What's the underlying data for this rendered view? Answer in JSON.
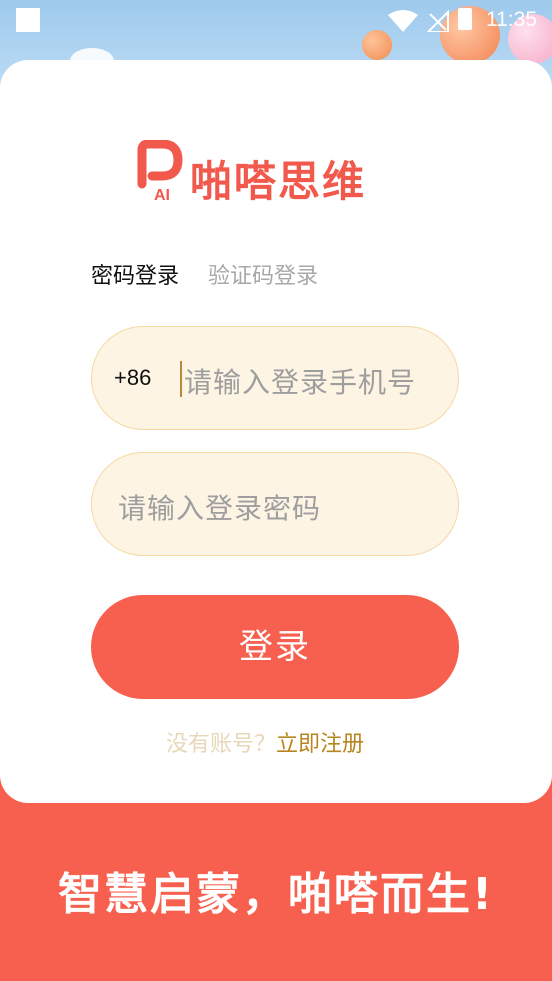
{
  "status_bar": {
    "time": "11:35"
  },
  "app": {
    "name": "啪嗒思维",
    "logo_letters": "AI"
  },
  "tabs": [
    {
      "label": "密码登录",
      "active": true
    },
    {
      "label": "验证码登录",
      "active": false
    }
  ],
  "phone_field": {
    "prefix": "+86",
    "value": "",
    "placeholder": "请输入登录手机号"
  },
  "password_field": {
    "value": "",
    "placeholder": "请输入登录密码"
  },
  "login_button": {
    "label": "登录"
  },
  "register": {
    "question": "没有账号？",
    "link": "立即注册"
  },
  "slogan": "智慧启蒙，啪嗒而生!",
  "colors": {
    "brand": "#f7604f",
    "logo": "#f2594d",
    "field_bg": "#fdf4e4",
    "field_border": "#f5d9a4",
    "link": "#b8861e",
    "muted": "#a8a8a8"
  }
}
